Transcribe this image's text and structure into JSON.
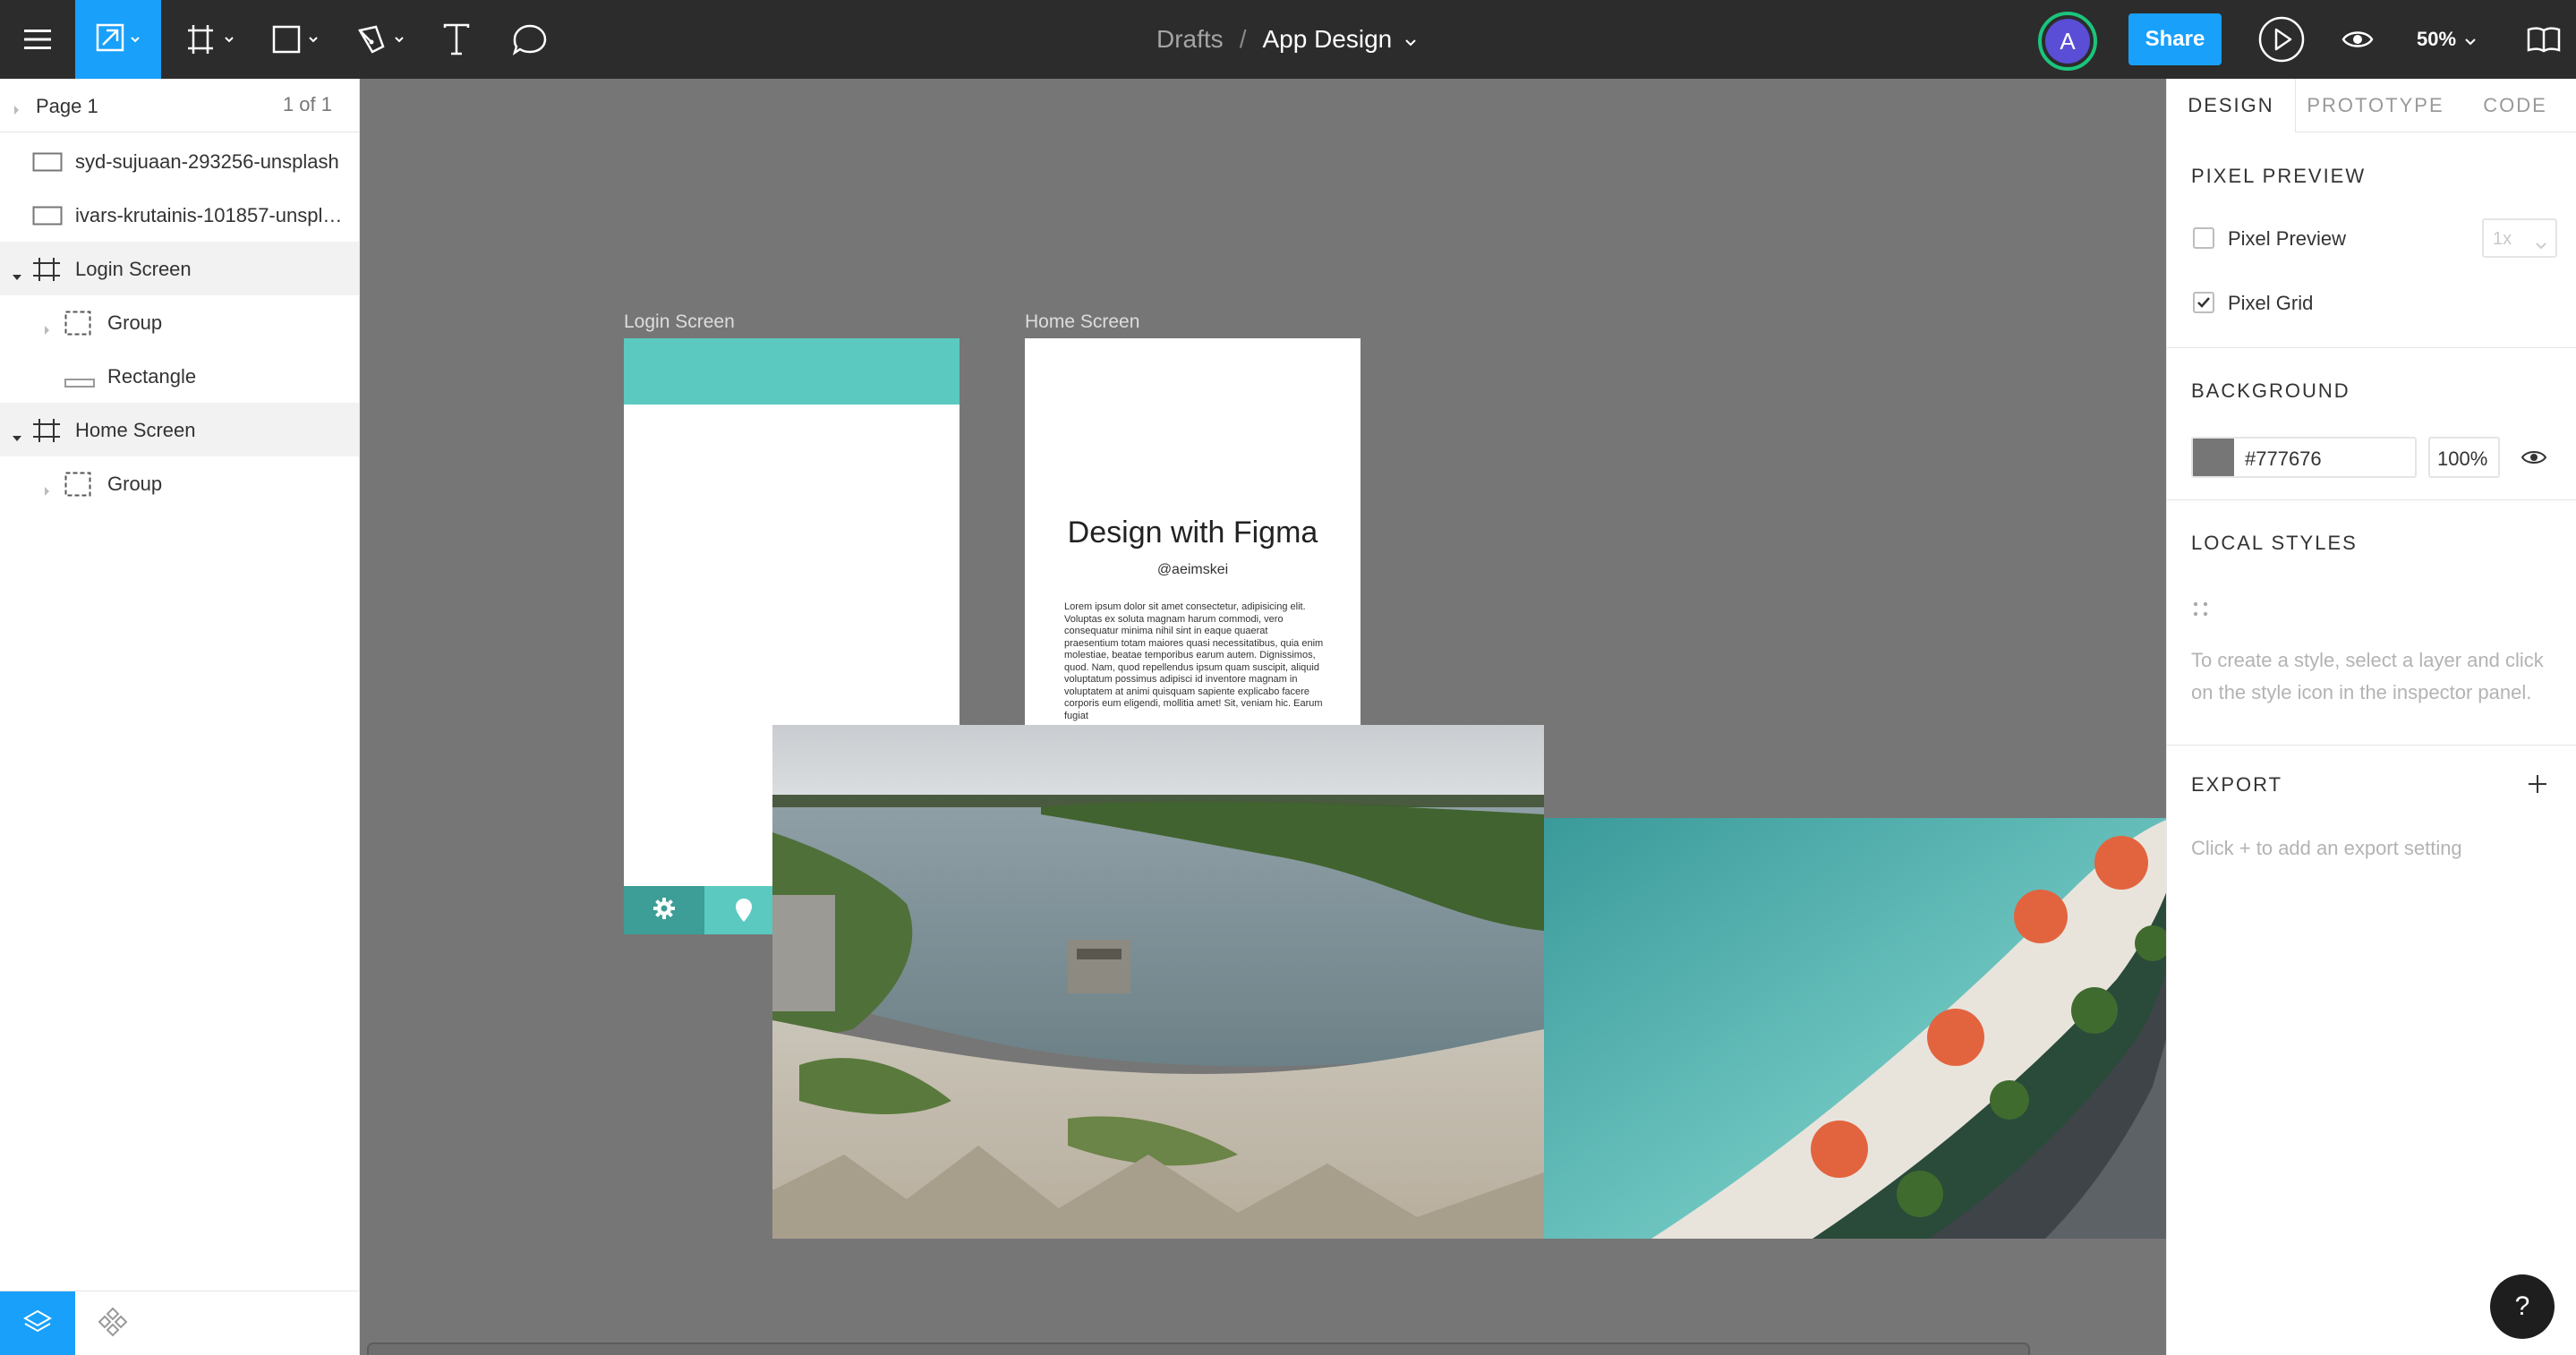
{
  "toolbar": {
    "menu_icon": "hamburger-icon",
    "move_tool_icon": "move-arrow-icon",
    "frame_tool_icon": "frame-icon",
    "shape_tool_icon": "rectangle-icon",
    "pen_tool_icon": "pen-icon",
    "text_tool_icon": "text-icon",
    "comment_tool_icon": "comment-icon",
    "breadcrumb_project": "Drafts",
    "breadcrumb_separator": "/",
    "file_name": "App Design",
    "avatar_initial": "A",
    "share_label": "Share",
    "zoom_label": "50%"
  },
  "layers_panel": {
    "page_name": "Page 1",
    "page_count": "1 of 1",
    "layers": [
      {
        "name": "syd-sujuaan-293256-unsplash",
        "type": "image"
      },
      {
        "name": "ivars-krutainis-101857-unspl…",
        "type": "image"
      },
      {
        "name": "Login Screen",
        "type": "frame"
      },
      {
        "name": "Group",
        "type": "group"
      },
      {
        "name": "Rectangle",
        "type": "rectangle"
      },
      {
        "name": "Home Screen",
        "type": "frame"
      },
      {
        "name": "Group",
        "type": "group"
      }
    ]
  },
  "canvas": {
    "login_frame_title": "Login Screen",
    "home_frame_title": "Home Screen",
    "home_heading": "Design with Figma",
    "home_handle": "@aeimskei",
    "home_body": "Lorem ipsum dolor sit amet consectetur, adipisicing elit. Voluptas ex soluta magnam harum commodi, vero consequatur minima nihil sint in eaque quaerat praesentium totam maiores quasi necessitatibus, quia enim molestiae, beatae temporibus earum autem. Dignissimos, quod. Nam, quod repellendus ipsum quam suscipit, aliquid voluptatum possimus adipisci id inventore magnam in voluptatem at animi quisquam sapiente explicabo facere corporis eum eligendi, mollitia amet! Sit, veniam hic. Earum fugiat",
    "login_header_color": "#5bc9c0",
    "login_footer_color": "#3c9e96"
  },
  "inspector": {
    "tabs": [
      "DESIGN",
      "PROTOTYPE",
      "CODE"
    ],
    "pixel_preview_title": "PIXEL PREVIEW",
    "pixel_preview_label": "Pixel Preview",
    "pixel_preview_checked": false,
    "pixel_scale": "1x",
    "pixel_grid_label": "Pixel Grid",
    "pixel_grid_checked": true,
    "background_title": "BACKGROUND",
    "background_hex": "#777676",
    "background_opacity": "100%",
    "local_styles_title": "LOCAL STYLES",
    "local_styles_help_1": "To create a style, select a layer and click",
    "local_styles_help_2": "on the style icon in the inspector panel.",
    "export_title": "EXPORT",
    "export_help": "Click + to add an export setting"
  },
  "help_label": "?"
}
